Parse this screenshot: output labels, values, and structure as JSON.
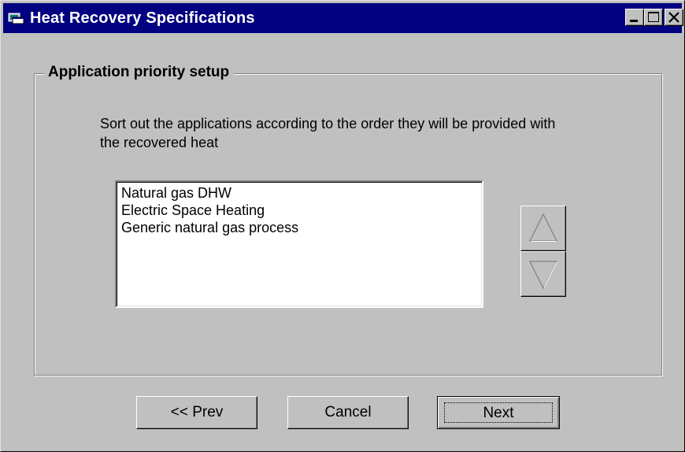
{
  "window": {
    "title": "Heat Recovery Specifications",
    "icon": "window-app-icon",
    "controls": {
      "minimize_icon": "minimize-icon",
      "maximize_icon": "maximize-icon",
      "close_icon": "close-icon"
    }
  },
  "group": {
    "title": "Application priority setup",
    "instructions": "Sort out the applications according to the order they will be provided with the recovered heat"
  },
  "applications": {
    "items": [
      {
        "label": "Natural gas DHW"
      },
      {
        "label": "Electric Space Heating"
      },
      {
        "label": "Generic natural gas process"
      }
    ]
  },
  "reorder": {
    "up_icon": "triangle-up-icon",
    "down_icon": "triangle-down-icon"
  },
  "footer": {
    "prev_label": "<< Prev",
    "cancel_label": "Cancel",
    "next_label": "Next"
  },
  "colors": {
    "title_bar": "#000080",
    "face": "#c0c0c0",
    "list_bg": "#ffffff"
  }
}
